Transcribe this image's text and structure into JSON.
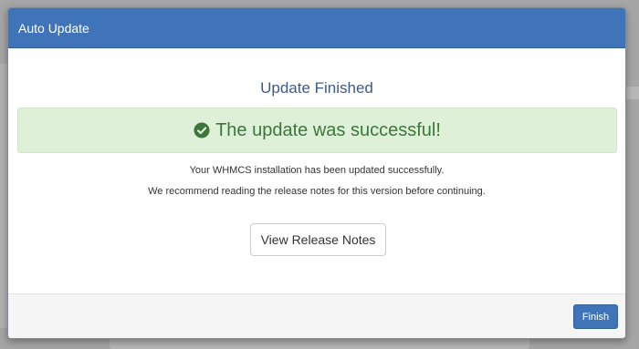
{
  "modal": {
    "title": "Auto Update",
    "heading": "Update Finished",
    "alert": {
      "text": "The update was successful!",
      "icon": "check-circle-icon",
      "color": "#3c763d",
      "background": "#dff0d8"
    },
    "message_line_1": "Your WHMCS installation has been updated successfully.",
    "message_line_2": "We recommend reading the release notes for this version before continuing.",
    "release_notes_button": "View Release Notes",
    "finish_button": "Finish"
  },
  "colors": {
    "header": "#3f74b9",
    "heading_text": "#3c5a8a"
  }
}
